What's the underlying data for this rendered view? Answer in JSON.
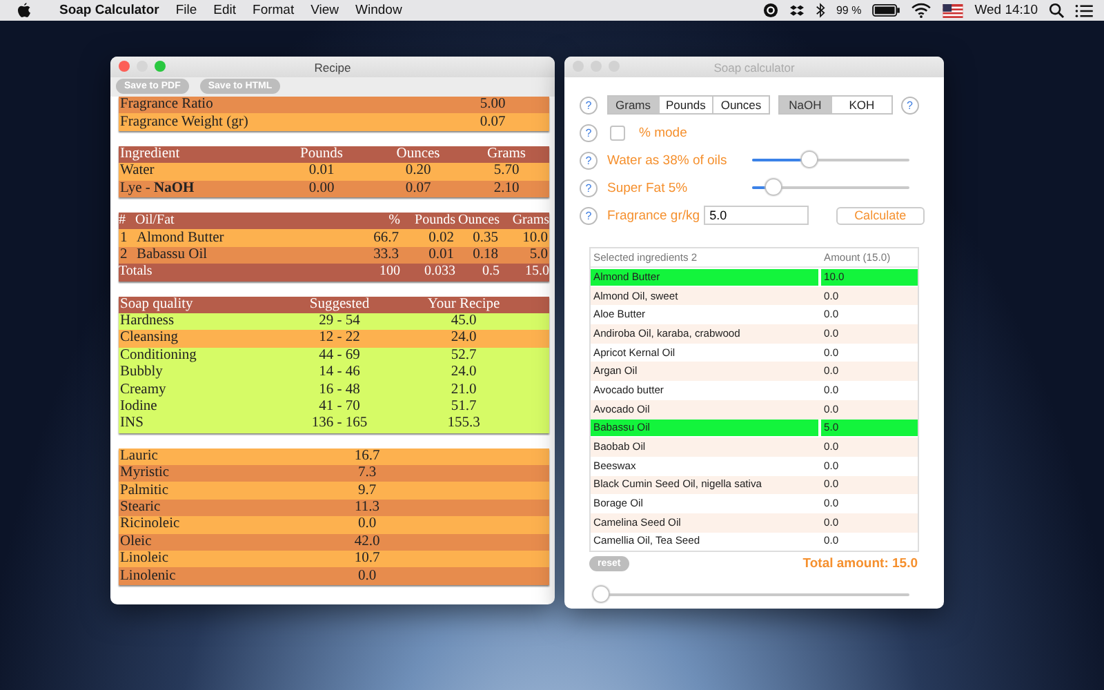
{
  "menubar": {
    "app": "Soap Calculator",
    "menus": [
      "File",
      "Edit",
      "Format",
      "View",
      "Window"
    ],
    "battery": "99 %",
    "clock": "Wed 14:10"
  },
  "recipe_window": {
    "title": "Recipe",
    "active": true,
    "buttons": [
      "Save to PDF",
      "Save to HTML"
    ],
    "fragrance_table": {
      "rows": [
        [
          "Fragrance Ratio",
          "5.00"
        ],
        [
          "Fragrance Weight (gr)",
          "0.07"
        ]
      ]
    },
    "ingredient_table": {
      "columns": [
        "Ingredient",
        "Pounds",
        "Ounces",
        "Grams"
      ],
      "rows": [
        [
          "Water",
          "0.01",
          "0.20",
          "5.70"
        ],
        [
          "Lye - **NaOH**",
          "0.00",
          "0.07",
          "2.10"
        ]
      ]
    },
    "oil_table": {
      "columns": [
        "#",
        "Oil/Fat",
        "%",
        "Pounds",
        "Ounces",
        "Grams"
      ],
      "rows": [
        [
          "1",
          "Almond Butter",
          "66.7",
          "0.02",
          "0.35",
          "10.0"
        ],
        [
          "2",
          "Babassu Oil",
          "33.3",
          "0.01",
          "0.18",
          "5.0"
        ]
      ],
      "totals": [
        "Totals",
        "100",
        "0.033",
        "0.5",
        "15.0"
      ]
    },
    "quality_table": {
      "columns": [
        "Soap quality",
        "Suggested",
        "Your Recipe"
      ],
      "rows": [
        {
          "cells": [
            "Hardness",
            "29 - 54",
            "45.0"
          ],
          "in_range": true
        },
        {
          "cells": [
            "Cleansing",
            "12 - 22",
            "24.0"
          ],
          "in_range": false
        },
        {
          "cells": [
            "Conditioning",
            "44 - 69",
            "52.7"
          ],
          "in_range": true
        },
        {
          "cells": [
            "Bubbly",
            "14 - 46",
            "24.0"
          ],
          "in_range": true
        },
        {
          "cells": [
            "Creamy",
            "16 - 48",
            "21.0"
          ],
          "in_range": true
        },
        {
          "cells": [
            "Iodine",
            "41 - 70",
            "51.7"
          ],
          "in_range": true
        },
        {
          "cells": [
            "INS",
            "136 - 165",
            "155.3"
          ],
          "in_range": true
        }
      ]
    },
    "fatty_acid_table": {
      "rows": [
        [
          "Lauric",
          "16.7"
        ],
        [
          "Myristic",
          "7.3"
        ],
        [
          "Palmitic",
          "9.7"
        ],
        [
          "Stearic",
          "11.3"
        ],
        [
          "Ricinoleic",
          "0.0"
        ],
        [
          "Oleic",
          "42.0"
        ],
        [
          "Linoleic",
          "10.7"
        ],
        [
          "Linolenic",
          "0.0"
        ]
      ]
    }
  },
  "calculator_window": {
    "title": "Soap calculator",
    "active": false,
    "units": [
      {
        "label": "Grams",
        "selected": true
      },
      {
        "label": "Pounds",
        "selected": false
      },
      {
        "label": "Ounces",
        "selected": false
      }
    ],
    "lye": [
      {
        "label": "NaOH",
        "selected": true
      },
      {
        "label": "KOH",
        "selected": false
      }
    ],
    "help_mark": "?",
    "percent_mode": {
      "label": "% mode",
      "checked": false
    },
    "water": {
      "label": "Water as 38% of oils",
      "level": 0.37
    },
    "super_fat": {
      "label": "Super Fat 5%",
      "level": 0.14
    },
    "fragrance": {
      "label": "Fragrance gr/kg",
      "value": "5.0"
    },
    "calculate_button": "Calculate",
    "ingredients": {
      "columns": [
        "Selected ingredients 2",
        "Amount (15.0)"
      ],
      "rows": [
        {
          "name": "Almond Butter",
          "amount": "10.0",
          "selected": true
        },
        {
          "name": "Almond Oil, sweet",
          "amount": "0.0",
          "selected": false
        },
        {
          "name": "Aloe Butter",
          "amount": "0.0",
          "selected": false
        },
        {
          "name": "Andiroba Oil, karaba, crabwood",
          "amount": "0.0",
          "selected": false
        },
        {
          "name": "Apricot Kernal Oil",
          "amount": "0.0",
          "selected": false
        },
        {
          "name": "Argan Oil",
          "amount": "0.0",
          "selected": false
        },
        {
          "name": "Avocado butter",
          "amount": "0.0",
          "selected": false
        },
        {
          "name": "Avocado Oil",
          "amount": "0.0",
          "selected": false
        },
        {
          "name": "Babassu Oil",
          "amount": "5.0",
          "selected": true
        },
        {
          "name": "Baobab Oil",
          "amount": "0.0",
          "selected": false
        },
        {
          "name": "Beeswax",
          "amount": "0.0",
          "selected": false
        },
        {
          "name": "Black Cumin Seed Oil, nigella sativa",
          "amount": "0.0",
          "selected": false
        },
        {
          "name": "Borage Oil",
          "amount": "0.0",
          "selected": false
        },
        {
          "name": "Camelina Seed Oil",
          "amount": "0.0",
          "selected": false
        },
        {
          "name": "Camellia Oil, Tea Seed",
          "amount": "0.0",
          "selected": false
        }
      ]
    },
    "reset_button": "reset",
    "total": "Total amount: 15.0",
    "bottom_slider": {
      "level": 0
    }
  }
}
